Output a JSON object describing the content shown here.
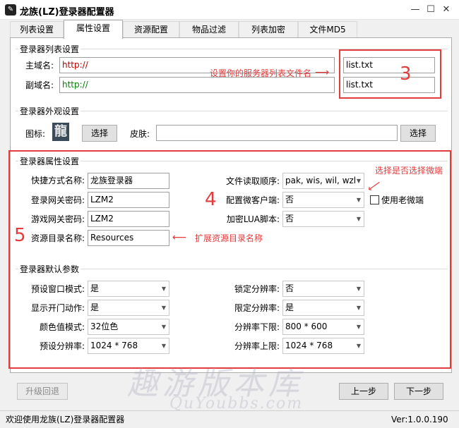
{
  "window": {
    "title": "龙族(LZ)登录器配置器",
    "minimize": "—",
    "maximize": "☐",
    "close": "✕"
  },
  "tabs": [
    {
      "label": "列表设置"
    },
    {
      "label": "属性设置"
    },
    {
      "label": "资源配置"
    },
    {
      "label": "物品过滤"
    },
    {
      "label": "列表加密"
    },
    {
      "label": "文件MD5"
    }
  ],
  "server_list": {
    "group_title": "登录器列表设置",
    "main_domain_label": "主域名:",
    "main_domain_value": "http://",
    "sub_domain_label": "副域名:",
    "sub_domain_value": "http://",
    "main_file": "list.txt",
    "sub_file": "list.txt",
    "annotation": "设置你的服务器列表文件名",
    "annotation_number": "3"
  },
  "appearance": {
    "group_title": "登录器外观设置",
    "icon_label": "图标:",
    "icon_glyph": "龍",
    "icon_select": "选择",
    "skin_label": "皮肤:",
    "skin_value": "",
    "skin_select": "选择"
  },
  "properties": {
    "group_title": "登录器属性设置",
    "shortcut_label": "快捷方式名称:",
    "shortcut_value": "龙族登录器",
    "login_pwd_label": "登录网关密码:",
    "login_pwd_value": "LZM2",
    "game_pwd_label": "游戏网关密码:",
    "game_pwd_value": "LZM2",
    "res_dir_label": "资源目录名称:",
    "res_dir_value": "Resources",
    "read_order_label": "文件读取顺序:",
    "read_order_value": "pak, wis, wil, wzl",
    "micro_client_label": "配置微客户端:",
    "micro_client_value": "否",
    "lua_label": "加密LUA脚本:",
    "lua_value": "否",
    "old_micro_label": "使用老微端",
    "annotation_micro": "选择是否选择微端",
    "annotation_res": "扩展资源目录名称",
    "annotation_number_4": "4",
    "annotation_number_5": "5"
  },
  "defaults": {
    "group_title": "登录器默认参数",
    "preset_window_label": "预设窗口模式:",
    "preset_window_value": "是",
    "door_anim_label": "显示开门动作:",
    "door_anim_value": "是",
    "color_mode_label": "颜色值模式:",
    "color_mode_value": "32位色",
    "preset_res_label": "预设分辨率:",
    "preset_res_value": "1024 * 768",
    "lock_res_label": "锁定分辨率:",
    "lock_res_value": "否",
    "limit_res_label": "限定分辨率:",
    "limit_res_value": "是",
    "res_min_label": "分辨率下限:",
    "res_min_value": "800 * 600",
    "res_max_label": "分辨率上限:",
    "res_max_value": "1024 * 768"
  },
  "footer": {
    "upgrade_back": "升级回退",
    "prev": "上一步",
    "next": "下一步",
    "status": "欢迎使用龙族(LZ)登录器配置器",
    "version": "Ver:1.0.0.190"
  },
  "watermark": {
    "text": "趣游版本库",
    "subtext": "QuYoubbs.com"
  },
  "colors": {
    "annotation_red": "#e33c3c",
    "url_red": "#c00000",
    "url_green": "#008000"
  }
}
